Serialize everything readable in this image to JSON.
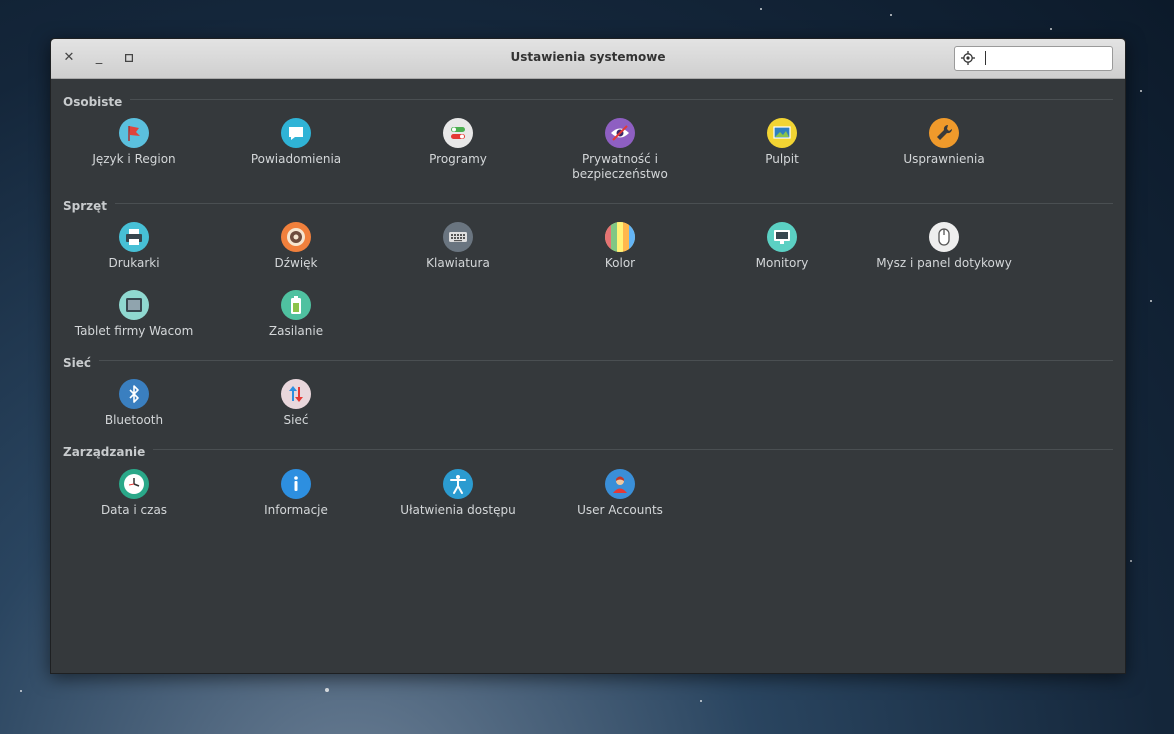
{
  "window": {
    "title": "Ustawienia systemowe"
  },
  "search": {
    "value": "",
    "placeholder": ""
  },
  "sections": {
    "personal": {
      "label": "Osobiste",
      "items": [
        {
          "label": "Język i Region"
        },
        {
          "label": "Powiadomienia"
        },
        {
          "label": "Programy"
        },
        {
          "label": "Prywatność i\nbezpieczeństwo"
        },
        {
          "label": "Pulpit"
        },
        {
          "label": "Usprawnienia"
        }
      ]
    },
    "hardware": {
      "label": "Sprzęt",
      "items": [
        {
          "label": "Drukarki"
        },
        {
          "label": "Dźwięk"
        },
        {
          "label": "Klawiatura"
        },
        {
          "label": "Kolor"
        },
        {
          "label": "Monitory"
        },
        {
          "label": "Mysz i panel dotykowy"
        },
        {
          "label": "Tablet firmy Wacom"
        },
        {
          "label": "Zasilanie"
        }
      ]
    },
    "network": {
      "label": "Sieć",
      "items": [
        {
          "label": "Bluetooth"
        },
        {
          "label": "Sieć"
        }
      ]
    },
    "administration": {
      "label": "Zarządzanie",
      "items": [
        {
          "label": "Data i czas"
        },
        {
          "label": "Informacje"
        },
        {
          "label": "Ułatwienia dostępu"
        },
        {
          "label": "User Accounts"
        }
      ]
    }
  },
  "icons": {
    "language-flag-icon": "#5bc0de",
    "notifications-icon": "#2fb3d6",
    "applications-icon": "#e8e8e8",
    "privacy-eye-icon": "#8e5fc2",
    "desktop-wallpaper-icon": "#f2d433",
    "tweaks-wrench-icon": "#f09a2b",
    "printer-icon": "#47c0d6",
    "sound-speaker-icon": "#f0803c",
    "keyboard-icon": "#6a7580",
    "color-stripes-icon": "#e8d36a",
    "monitor-icon": "#5bd0c3",
    "mouse-icon": "#eeeeee",
    "wacom-tablet-icon": "#8fd8d0",
    "power-battery-icon": "#4fc1a0",
    "bluetooth-icon": "#3a7fc0",
    "network-arrows-icon": "#e9d7dc",
    "clock-icon": "#2aa889",
    "info-icon": "#2d8fe0",
    "accessibility-icon": "#2b9bd0",
    "user-accounts-icon": "#3a8fd8"
  }
}
